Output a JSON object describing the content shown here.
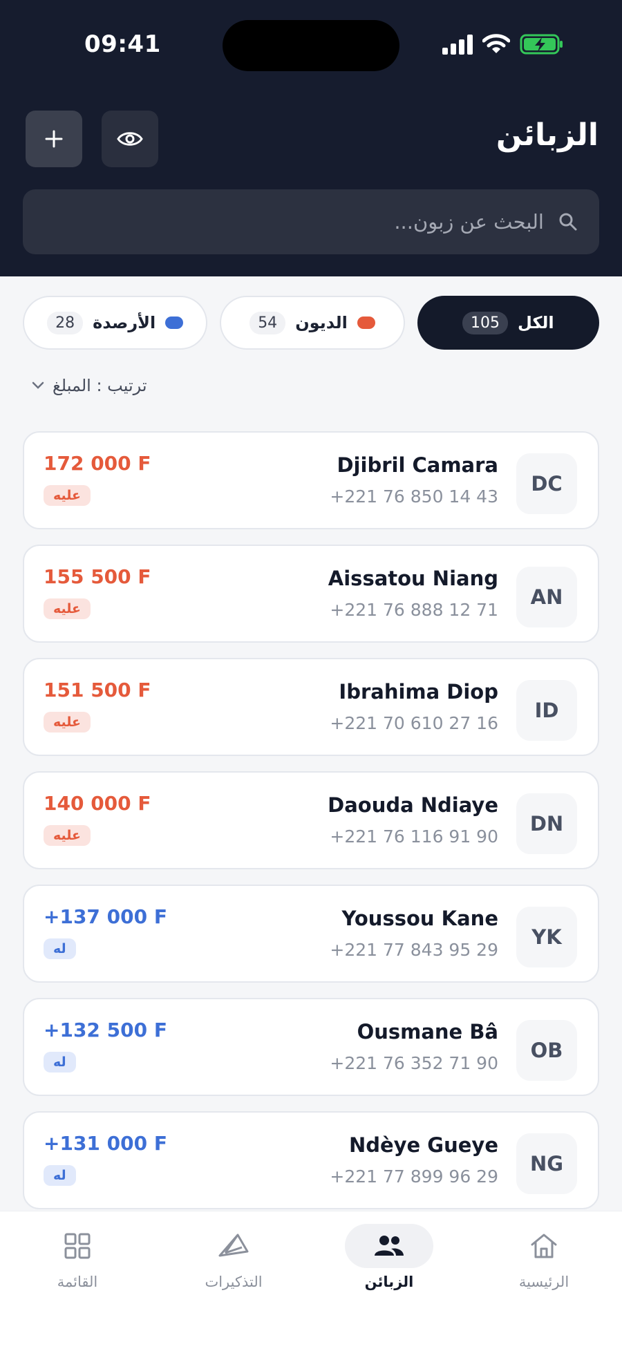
{
  "status_bar": {
    "time": "09:41"
  },
  "header": {
    "title": "الزبائن"
  },
  "search": {
    "placeholder": "البحث عن زبون..."
  },
  "filters": [
    {
      "label": "الكل",
      "count": "105",
      "active": true
    },
    {
      "label": "الديون",
      "count": "54",
      "dot_color": "#e55a3b"
    },
    {
      "label": "الأرصدة",
      "count": "28",
      "dot_color": "#3d6fd6"
    }
  ],
  "sort": {
    "label": "ترتيب : المبلغ"
  },
  "customers": [
    {
      "initials": "DC",
      "name": "Djibril Camara",
      "phone": "+221 76 850 14 43",
      "amount": "172 000 F",
      "badge": "عليه",
      "type": "debt"
    },
    {
      "initials": "AN",
      "name": "Aissatou Niang",
      "phone": "+221 76 888 12 71",
      "amount": "155 500 F",
      "badge": "عليه",
      "type": "debt"
    },
    {
      "initials": "ID",
      "name": "Ibrahima Diop",
      "phone": "+221 70 610 27 16",
      "amount": "151 500 F",
      "badge": "عليه",
      "type": "debt"
    },
    {
      "initials": "DN",
      "name": "Daouda Ndiaye",
      "phone": "+221 76 116 91 90",
      "amount": "140 000 F",
      "badge": "عليه",
      "type": "debt"
    },
    {
      "initials": "YK",
      "name": "Youssou Kane",
      "phone": "+221 77 843 95 29",
      "amount": "+137 000 F",
      "badge": "له",
      "type": "credit"
    },
    {
      "initials": "OB",
      "name": "Ousmane Bâ",
      "phone": "+221 76 352 71 90",
      "amount": "+132 500 F",
      "badge": "له",
      "type": "credit"
    },
    {
      "initials": "NG",
      "name": "Ndèye Gueye",
      "phone": "+221 77 899 96 29",
      "amount": "+131 000 F",
      "badge": "له",
      "type": "credit"
    }
  ],
  "tabs": [
    {
      "label": "الرئيسية",
      "icon": "home-icon"
    },
    {
      "label": "الزبائن",
      "icon": "users-icon",
      "active": true
    },
    {
      "label": "التذكيرات",
      "icon": "send-icon"
    },
    {
      "label": "القائمة",
      "icon": "grid-icon"
    }
  ],
  "colors": {
    "header_bg": "#161c2e",
    "debt": "#e55a3b",
    "credit": "#3d6fd6",
    "battery": "#34c759"
  }
}
